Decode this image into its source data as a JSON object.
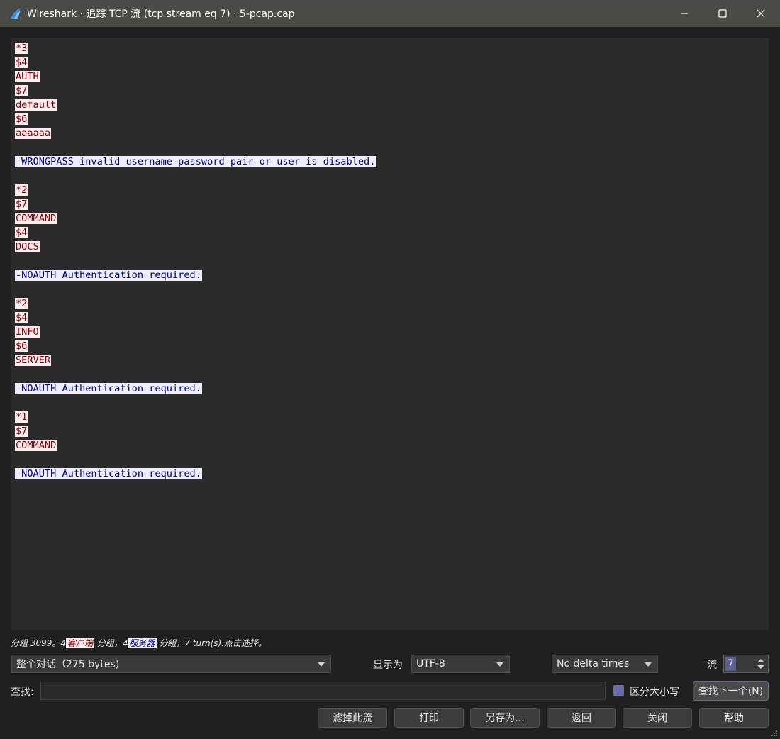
{
  "window": {
    "title": "Wireshark · 追踪 TCP 流 (tcp.stream eq 7) · 5-pcap.cap"
  },
  "stream": {
    "lines": [
      {
        "dir": "client",
        "text": "*3"
      },
      {
        "dir": "client",
        "text": "$4"
      },
      {
        "dir": "client",
        "text": "AUTH"
      },
      {
        "dir": "client",
        "text": "$7"
      },
      {
        "dir": "client",
        "text": "default"
      },
      {
        "dir": "client",
        "text": "$6"
      },
      {
        "dir": "client",
        "text": "aaaaaa"
      },
      {
        "dir": "blank",
        "text": ""
      },
      {
        "dir": "server",
        "text": "-WRONGPASS invalid username-password pair or user is disabled."
      },
      {
        "dir": "blank",
        "text": ""
      },
      {
        "dir": "client",
        "text": "*2"
      },
      {
        "dir": "client",
        "text": "$7"
      },
      {
        "dir": "client",
        "text": "COMMAND"
      },
      {
        "dir": "client",
        "text": "$4"
      },
      {
        "dir": "client",
        "text": "DOCS"
      },
      {
        "dir": "blank",
        "text": ""
      },
      {
        "dir": "server",
        "text": "-NOAUTH Authentication required."
      },
      {
        "dir": "blank",
        "text": ""
      },
      {
        "dir": "client",
        "text": "*2"
      },
      {
        "dir": "client",
        "text": "$4"
      },
      {
        "dir": "client",
        "text": "INFO"
      },
      {
        "dir": "client",
        "text": "$6"
      },
      {
        "dir": "client",
        "text": "SERVER"
      },
      {
        "dir": "blank",
        "text": ""
      },
      {
        "dir": "server",
        "text": "-NOAUTH Authentication required."
      },
      {
        "dir": "blank",
        "text": ""
      },
      {
        "dir": "client",
        "text": "*1"
      },
      {
        "dir": "client",
        "text": "$7"
      },
      {
        "dir": "client",
        "text": "COMMAND"
      },
      {
        "dir": "blank",
        "text": ""
      },
      {
        "dir": "server",
        "text": "-NOAUTH Authentication required."
      }
    ]
  },
  "status": {
    "prefix": "分组 3099。4",
    "client_tag": "客户端",
    "middle": "分组，4",
    "server_tag": "服务器",
    "suffix": "分组，7 turn(s).点击选择。"
  },
  "controls": {
    "conversation_select": "整个对话（275 bytes)",
    "show_as_label": "显示为",
    "encoding_select": "UTF-8",
    "delta_select": "No delta times",
    "stream_label": "流",
    "stream_value": "7",
    "find_label": "查找:",
    "find_value": "",
    "case_sensitive_label": "区分大小写",
    "find_next_button": "查找下一个(N)"
  },
  "buttons": {
    "filter_out": "滤掉此流",
    "print": "打印",
    "save_as": "另存为...",
    "back": "返回",
    "close": "关闭",
    "help": "帮助"
  },
  "colors": {
    "client_bg": "#fbeded",
    "client_fg": "#7f0000",
    "server_bg": "#ededfb",
    "server_fg": "#00007f"
  }
}
